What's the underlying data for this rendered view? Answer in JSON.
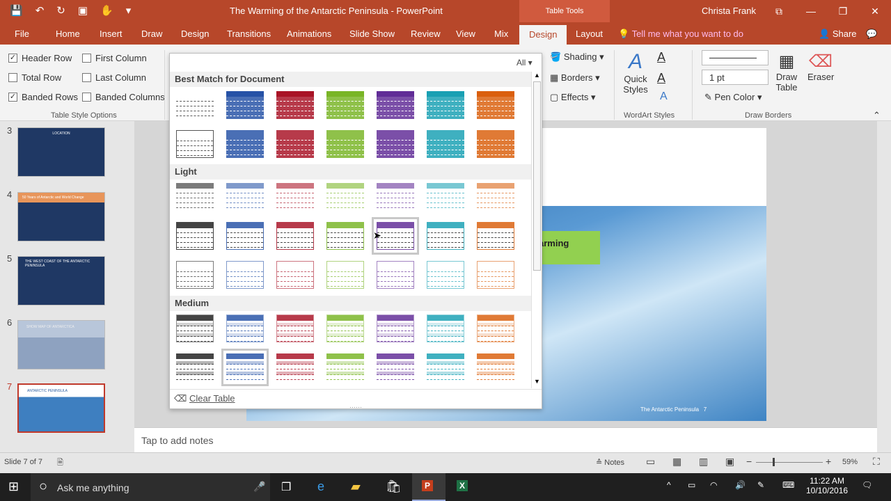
{
  "window": {
    "title": "The Warming of the Antarctic Peninsula - PowerPoint",
    "context_tab_group": "Table Tools",
    "user": "Christa Frank"
  },
  "qat": {
    "save": "💾",
    "undo": "↶",
    "redo": "↻",
    "present": "▣",
    "touch": "✋",
    "more": "▾"
  },
  "window_controls": {
    "ribbon_display": "⧉",
    "minimize": "—",
    "restore": "❐",
    "close": "✕"
  },
  "tabs": [
    "File",
    "Home",
    "Insert",
    "Draw",
    "Design",
    "Transitions",
    "Animations",
    "Slide Show",
    "Review",
    "View",
    "Mix",
    "Design",
    "Layout"
  ],
  "tell_me": "Tell me what you want to do",
  "share": "Share",
  "table_style_options": {
    "group_label": "Table Style Options",
    "items": [
      {
        "label": "Header Row",
        "checked": true
      },
      {
        "label": "First Column",
        "checked": false
      },
      {
        "label": "Total Row",
        "checked": false
      },
      {
        "label": "Last Column",
        "checked": false
      },
      {
        "label": "Banded Rows",
        "checked": true
      },
      {
        "label": "Banded Columns",
        "checked": false
      }
    ]
  },
  "table_styles_ribbon": {
    "shading": "Shading",
    "borders": "Borders",
    "effects": "Effects"
  },
  "wordart": {
    "quick_styles": "Quick Styles",
    "group_label": "WordArt Styles"
  },
  "draw_borders": {
    "pen_weight": "1 pt",
    "pen_color": "Pen Color",
    "draw_table": "Draw Table",
    "eraser": "Eraser",
    "group_label": "Draw Borders"
  },
  "gallery": {
    "filter": "All",
    "sections": [
      "Best Match for Document",
      "Light",
      "Medium"
    ],
    "colors": [
      "#444444",
      "#4a6fb5",
      "#b73a4a",
      "#8fc14a",
      "#7b4fa8",
      "#3fb0c0",
      "#e07a35"
    ],
    "clear_table": "Clear Table"
  },
  "slides": [
    {
      "num": "3",
      "title": "LOCATION"
    },
    {
      "num": "4",
      "title": "50 Years of Antarctic and World Change"
    },
    {
      "num": "5",
      "title": "THE WEST COAST OF THE ANTARCTIC PENINSULA"
    },
    {
      "num": "6",
      "title": "SHOW MAP OF ANTARCTICA"
    },
    {
      "num": "7",
      "title": "ANTARCTIC PENINSULA"
    }
  ],
  "slide": {
    "green_text": "arming",
    "footer": "The Antarctic Peninsula",
    "page": "7"
  },
  "notes_placeholder": "Tap to add notes",
  "status": {
    "slide_counter": "Slide 7 of 7",
    "notes": "Notes",
    "zoom": "59%"
  },
  "taskbar": {
    "search": "Ask me anything",
    "time": "11:22 AM",
    "date": "10/10/2016"
  }
}
